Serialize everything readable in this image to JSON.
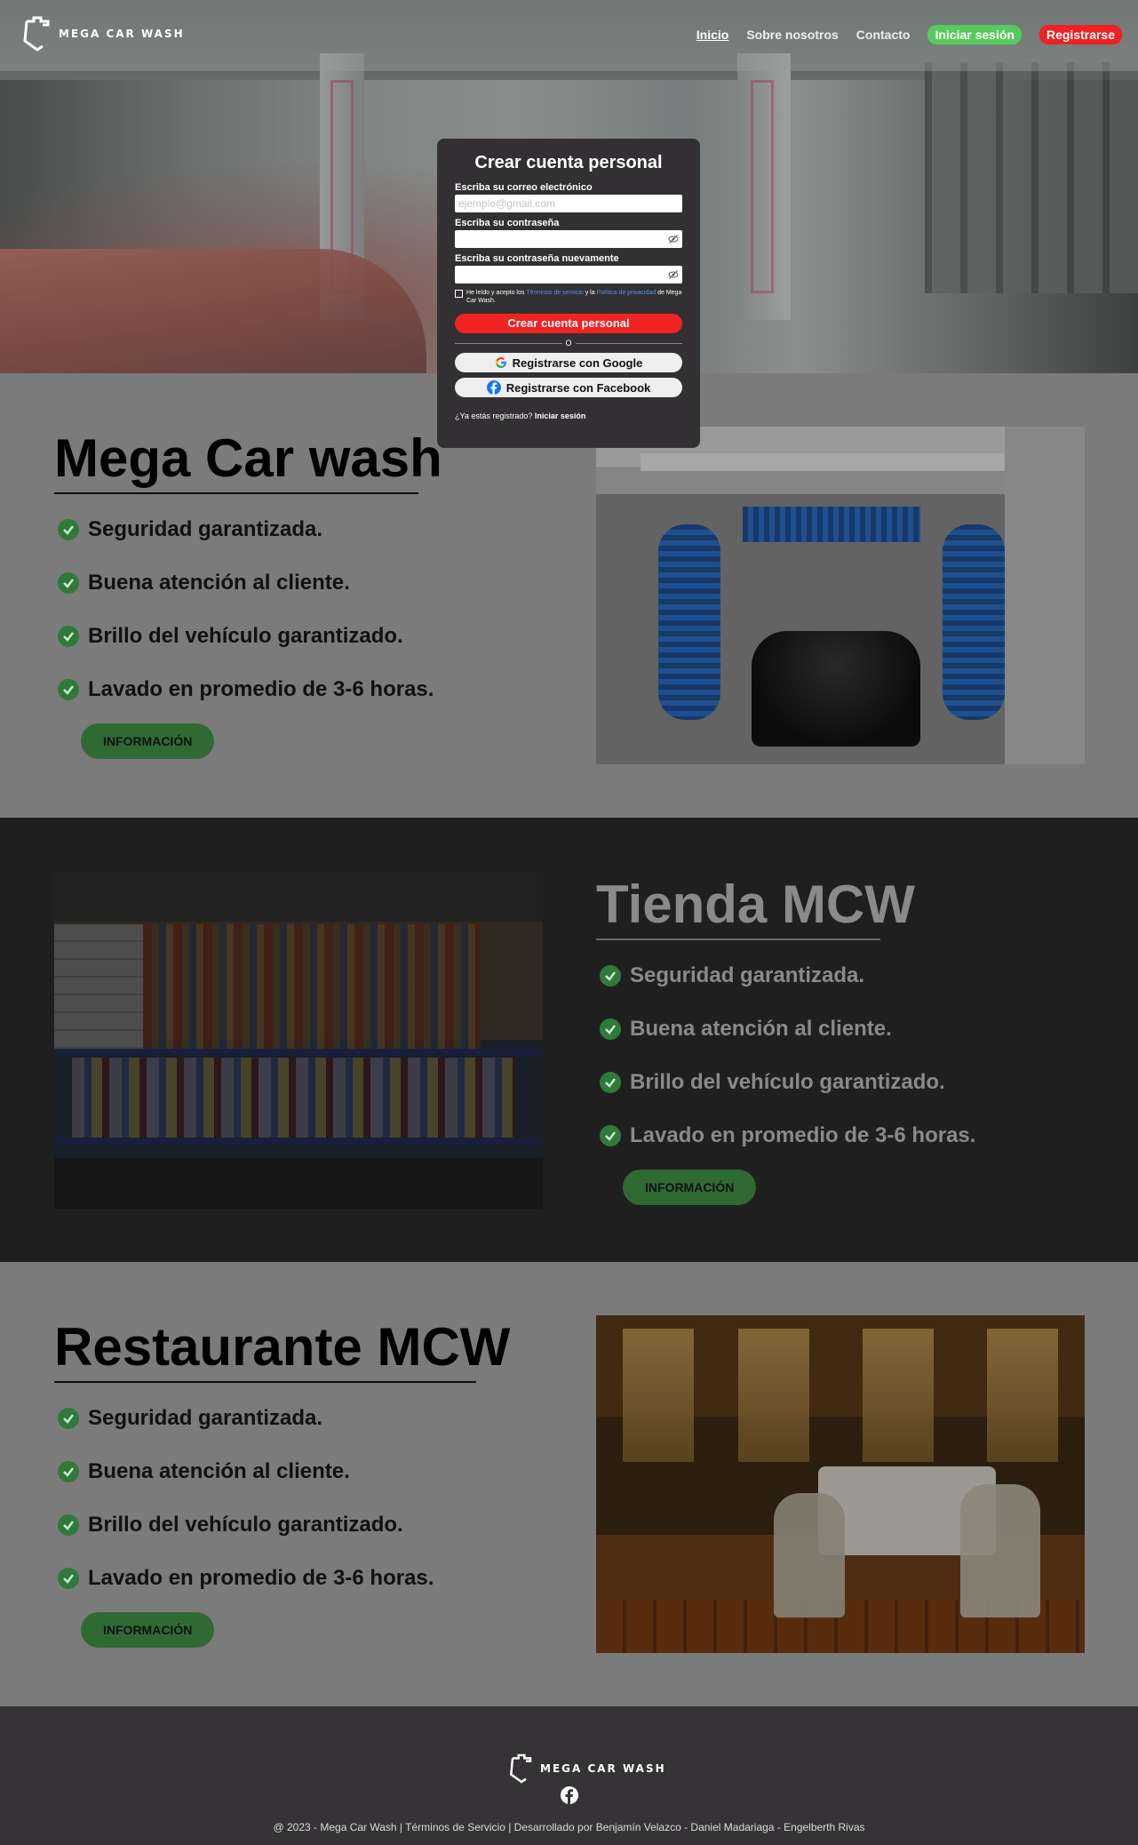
{
  "nav": {
    "logo_text": "MEGA CAR WASH",
    "links": [
      "Inicio",
      "Sobre nosotros",
      "Contacto"
    ],
    "login_label": "Iniciar sesión",
    "register_label": "Registrarse"
  },
  "modal": {
    "title": "Crear cuenta personal",
    "email_label": "Escriba su correo electrónico",
    "email_placeholder": "ejemplo@gmail.com",
    "password_label": "Escriba su contraseña",
    "password_repeat_label": "Escriba su contraseña nuevamente",
    "terms_prefix": "He leído y acepto los",
    "terms_link": "Términos de servicio",
    "terms_mid": "y la",
    "privacy_link": "Política de privacidad",
    "terms_suffix": "de Mega Car Wash.",
    "create_button": "Crear cuenta personal",
    "or_text": "O",
    "google_button": "Registrarse con Google",
    "facebook_button": "Registrarse con Facebook",
    "already_text": "¿Ya estás registrado?",
    "already_link": "Iniciar sesión"
  },
  "sections": [
    {
      "title": "Mega Car wash",
      "features": [
        "Seguridad garantizada.",
        "Buena atención al cliente.",
        "Brillo del vehículo garantizado.",
        "Lavado en promedio de 3-6 horas."
      ],
      "button": "INFORMACIÓN"
    },
    {
      "title": "Tienda MCW",
      "features": [
        "Seguridad garantizada.",
        "Buena atención al cliente.",
        "Brillo del vehículo garantizado.",
        "Lavado en promedio de 3-6 horas."
      ],
      "button": "INFORMACIÓN"
    },
    {
      "title": "Restaurante MCW",
      "features": [
        "Seguridad garantizada.",
        "Buena atención al cliente.",
        "Brillo del vehículo garantizado.",
        "Lavado en promedio de 3-6 horas."
      ],
      "button": "INFORMACIÓN"
    }
  ],
  "footer": {
    "logo_text": "MEGA CAR WASH",
    "copyright": "@ 2023 - Mega Car Wash | Términos de Servicio | Desarrollado por Benjamín Velazco - Daniel Madariaga - Engelberth Rivas"
  },
  "colors": {
    "accent_green": "#58c95c",
    "accent_red": "#ee2222",
    "check_green": "#2f7a3a",
    "dark_section": "#1f1f1f",
    "footer_bg": "#353335"
  }
}
